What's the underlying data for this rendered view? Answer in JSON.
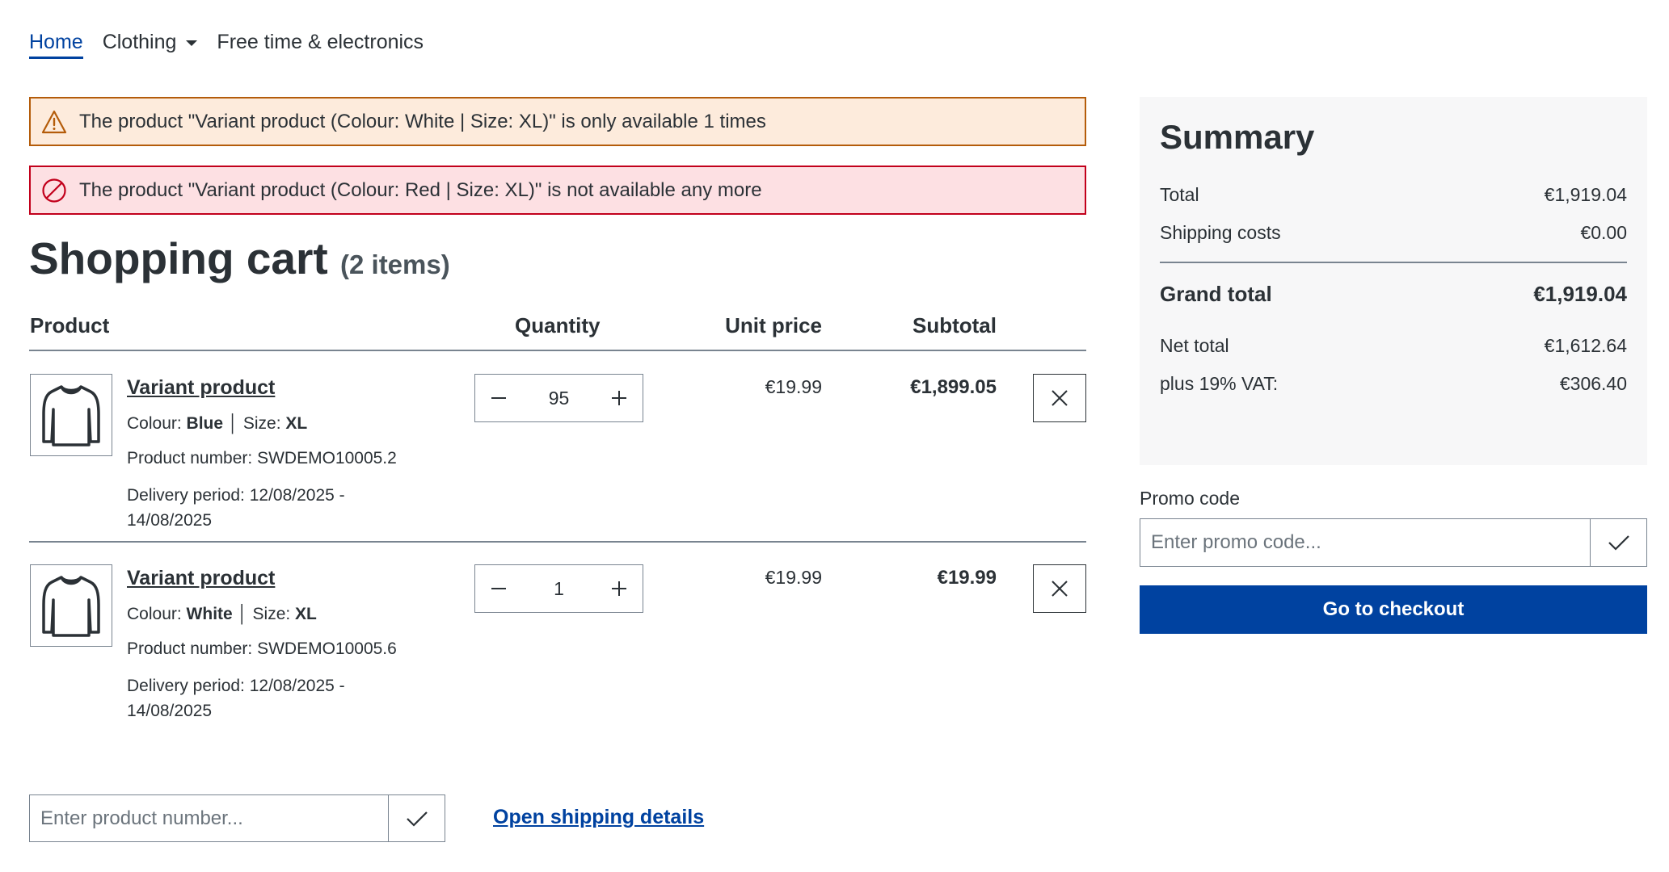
{
  "nav": {
    "items": [
      {
        "label": "Home",
        "active": true
      },
      {
        "label": "Clothing",
        "has_dropdown": true
      },
      {
        "label": "Free time & electronics"
      }
    ]
  },
  "alerts": {
    "warning": "The product \"Variant product (Colour: White | Size: XL)\" is only available 1 times",
    "error": "The product \"Variant product (Colour: Red | Size: XL)\" is not available any more"
  },
  "cart": {
    "title": "Shopping cart",
    "count_label": "(2 items)",
    "headers": {
      "product": "Product",
      "quantity": "Quantity",
      "unit_price": "Unit price",
      "subtotal": "Subtotal"
    },
    "items": [
      {
        "name": "Variant product",
        "colour_label": "Colour:",
        "colour": "Blue",
        "size_label": "Size:",
        "size": "XL",
        "product_number": "Product number: SWDEMO10005.2",
        "delivery_line1": "Delivery period: 12/08/2025 -",
        "delivery_line2": "14/08/2025",
        "quantity": "95",
        "unit_price": "€19.99",
        "subtotal": "€1,899.05"
      },
      {
        "name": "Variant product",
        "colour_label": "Colour:",
        "colour": "White",
        "size_label": "Size:",
        "size": "XL",
        "product_number": "Product number: SWDEMO10005.6",
        "delivery_line1": "Delivery period: 12/08/2025 -",
        "delivery_line2": "14/08/2025",
        "quantity": "1",
        "unit_price": "€19.99",
        "subtotal": "€19.99"
      }
    ]
  },
  "add_product": {
    "placeholder": "Enter product number..."
  },
  "shipping_link": "Open shipping details",
  "summary": {
    "title": "Summary",
    "total_label": "Total",
    "total": "€1,919.04",
    "shipping_label": "Shipping costs",
    "shipping": "€0.00",
    "grand_label": "Grand total",
    "grand": "€1,919.04",
    "net_label": "Net total",
    "net": "€1,612.64",
    "vat_label": "plus 19% VAT:",
    "vat": "€306.40"
  },
  "promo": {
    "label": "Promo code",
    "placeholder": "Enter promo code..."
  },
  "checkout_label": "Go to checkout",
  "colors": {
    "primary": "#0042a0",
    "text": "#2b3136",
    "warning_bg": "#fdebdc",
    "warning_border": "#b45c0a",
    "error_bg": "#fde0e3",
    "error_border": "#c2001b",
    "summary_bg": "#f7f7f8"
  }
}
